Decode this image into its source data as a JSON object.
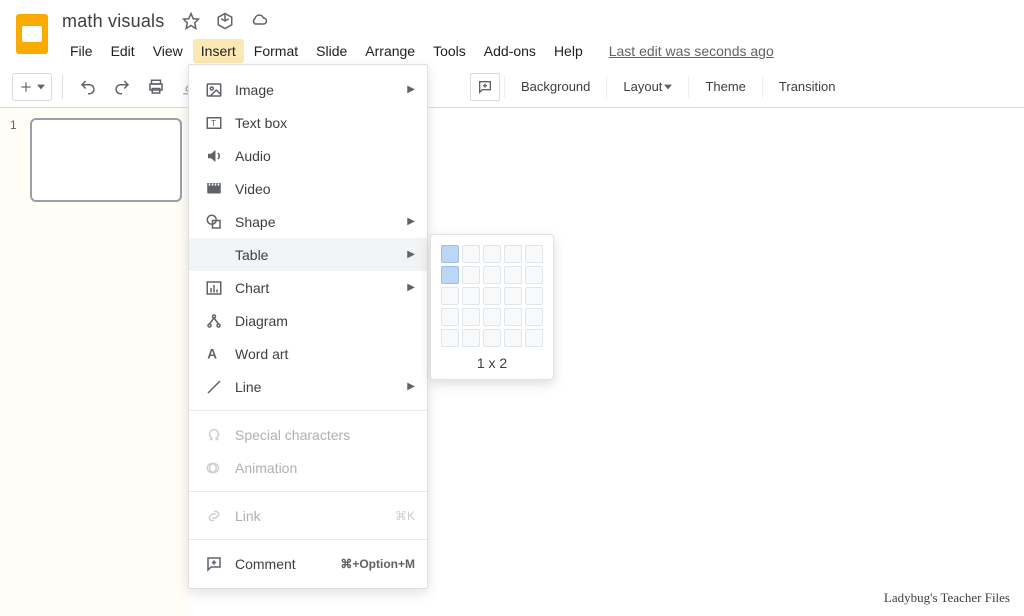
{
  "doc": {
    "title": "math visuals"
  },
  "menu": {
    "file": "File",
    "edit": "Edit",
    "view": "View",
    "insert": "Insert",
    "format": "Format",
    "slide": "Slide",
    "arrange": "Arrange",
    "tools": "Tools",
    "addons": "Add-ons",
    "help": "Help",
    "last_edit": "Last edit was seconds ago"
  },
  "toolbar": {
    "background": "Background",
    "layout": "Layout",
    "theme": "Theme",
    "transition": "Transition"
  },
  "insert_menu": {
    "image": "Image",
    "textbox": "Text box",
    "audio": "Audio",
    "video": "Video",
    "shape": "Shape",
    "table": "Table",
    "chart": "Chart",
    "diagram": "Diagram",
    "wordart": "Word art",
    "line": "Line",
    "special": "Special characters",
    "animation": "Animation",
    "link": "Link",
    "link_shortcut": "⌘K",
    "comment": "Comment",
    "comment_shortcut": "⌘+Option+M"
  },
  "table_picker": {
    "label": "1 x 2",
    "rows": 5,
    "cols": 5,
    "selected_rows": 2,
    "selected_cols": 1
  },
  "slides": {
    "first_number": "1"
  },
  "watermark": "Ladybug's Teacher Files"
}
